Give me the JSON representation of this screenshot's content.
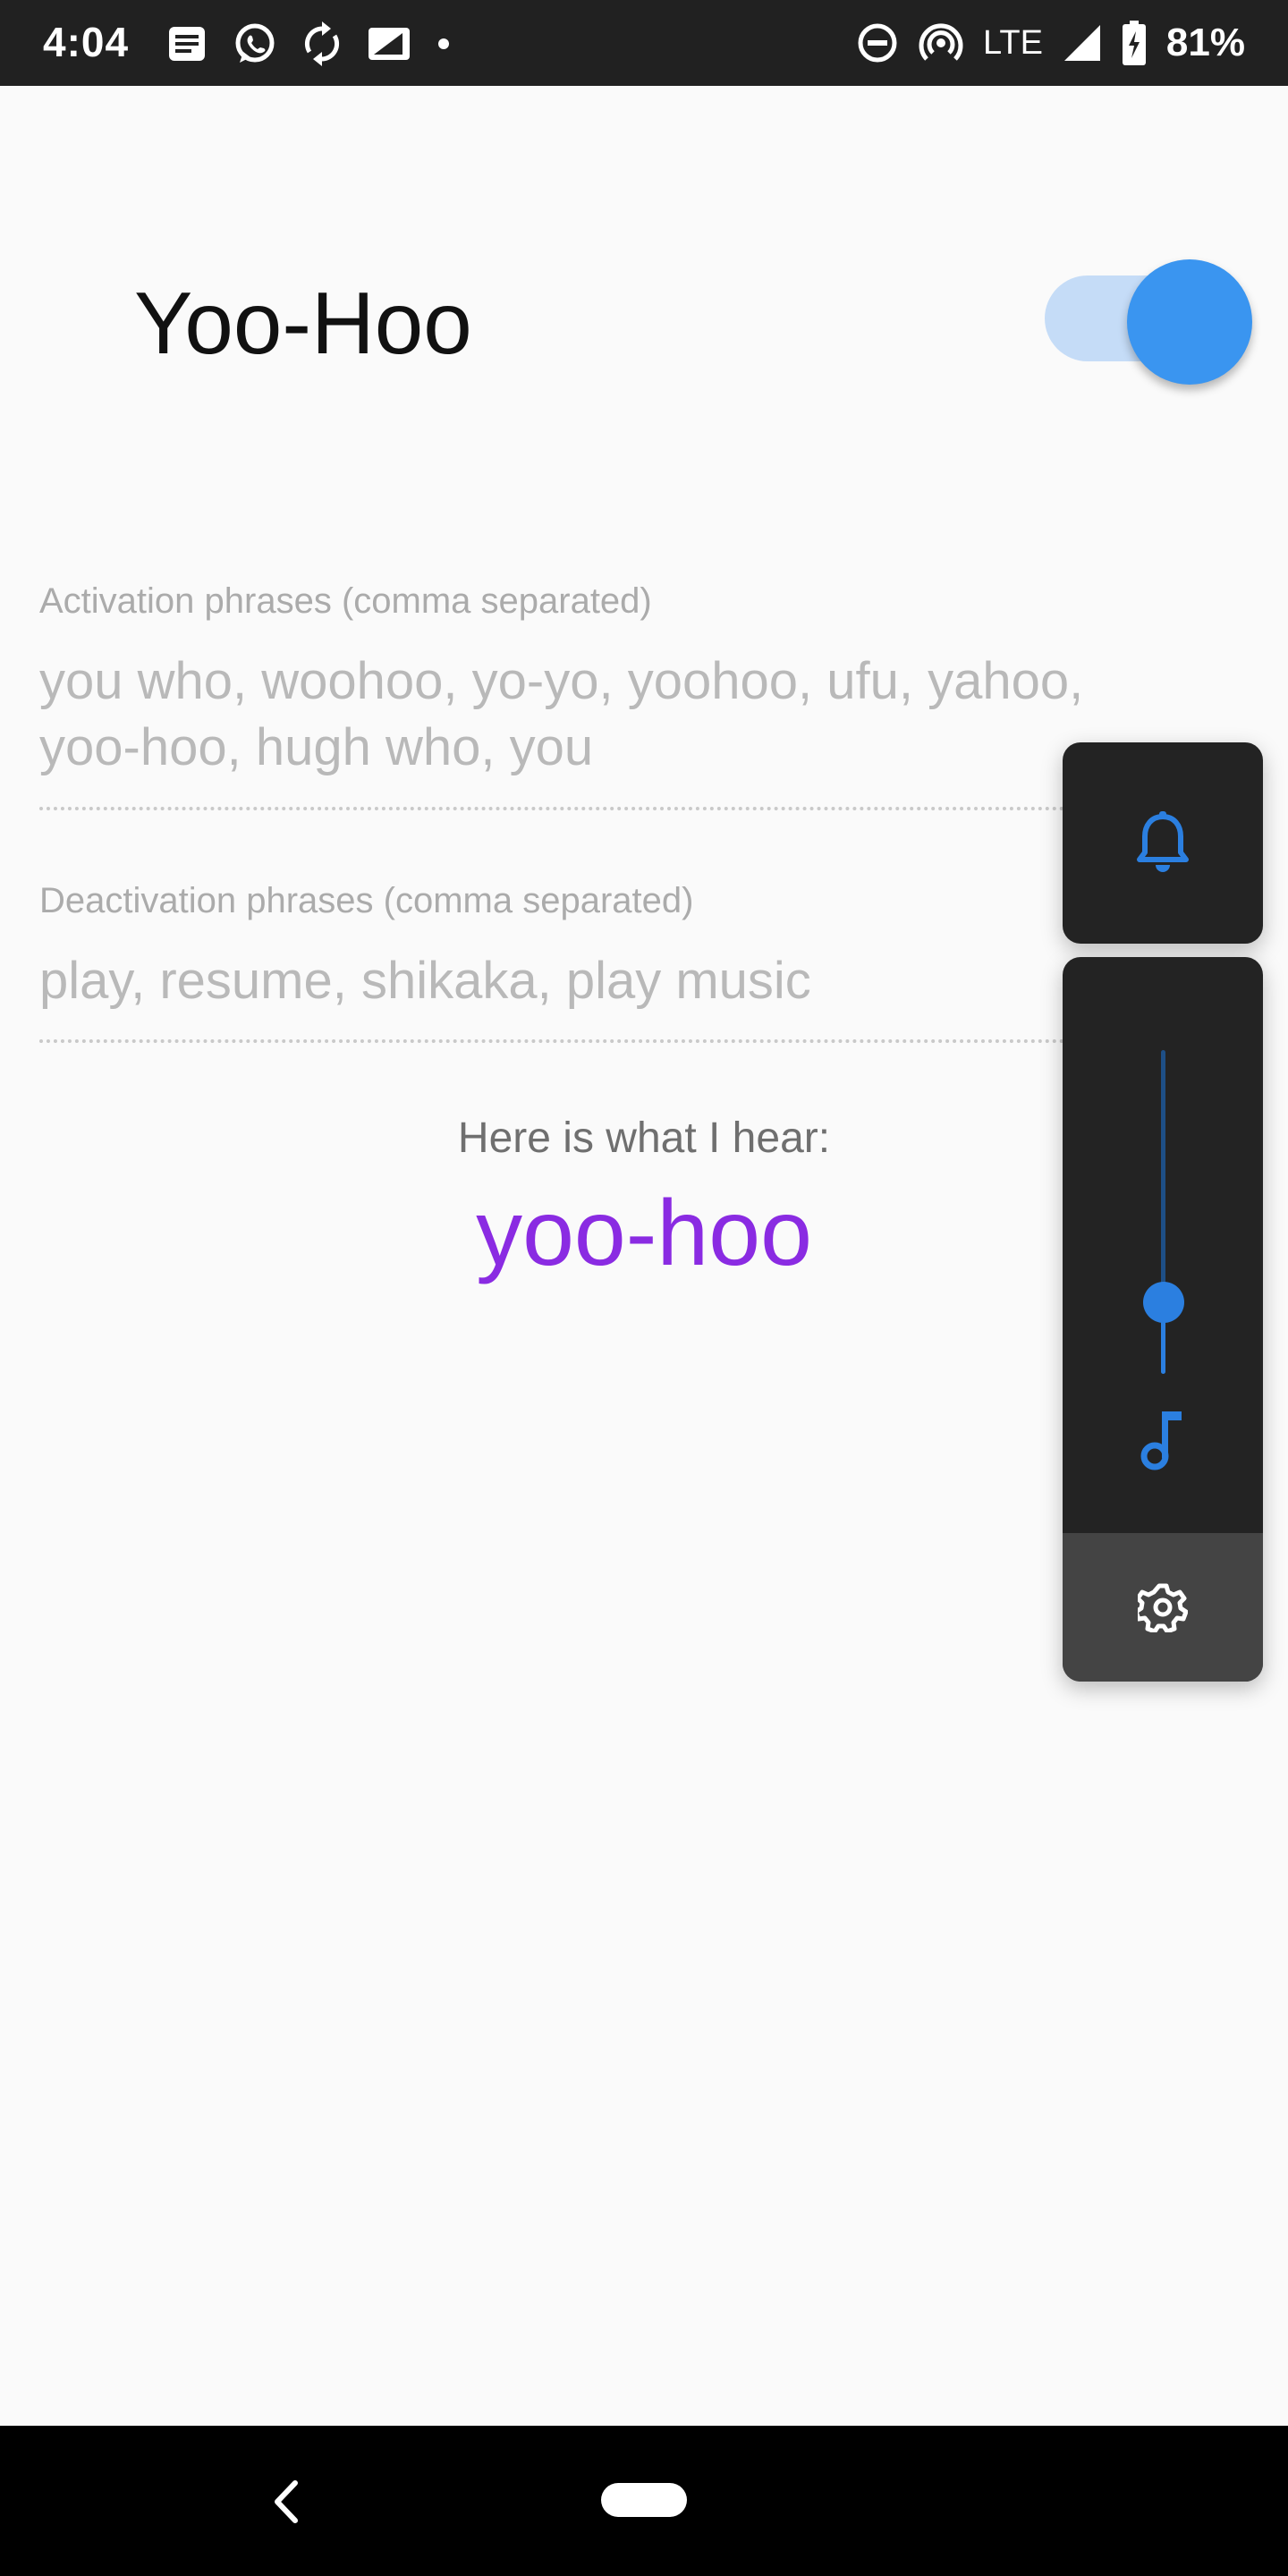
{
  "status_bar": {
    "time": "4:04",
    "network": "LTE",
    "battery": "81%",
    "left_icons": [
      "notification-icon",
      "whatsapp-icon",
      "sync-icon",
      "screenshot-icon",
      "dot-icon"
    ],
    "right_icons": [
      "dnd-icon",
      "hotspot-icon",
      "signal-icon",
      "battery-icon"
    ]
  },
  "header": {
    "title": "Yoo-Hoo",
    "toggle_on": true
  },
  "activation": {
    "label": "Activation phrases (comma separated)",
    "value": "you who, woohoo, yo-yo, yoohoo, ufu, yahoo, yoo-hoo, hugh who, you"
  },
  "deactivation": {
    "label": "Deactivation phrases (comma separated)",
    "value": "play, resume, shikaka, play music"
  },
  "hear": {
    "label": "Here is what I hear:",
    "value": "yoo-hoo"
  },
  "volume_panel": {
    "ringer_icon": "bell-icon",
    "media_icon": "music-note-icon",
    "settings_icon": "gear-icon",
    "media_level": 0.22
  },
  "colors": {
    "accent": "#3a95f0",
    "heard_text": "#8a2be2",
    "panel_bg": "#232323"
  }
}
